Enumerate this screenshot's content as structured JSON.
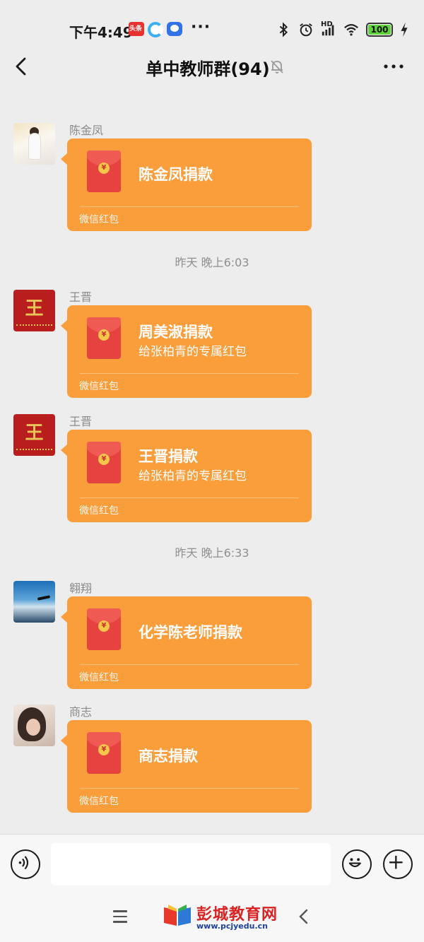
{
  "status_bar": {
    "time": "下午4:49",
    "app_badge": "头条",
    "battery": "100",
    "battery_level": 1.0,
    "network_label": "HD"
  },
  "header": {
    "title": "单中教师群(94)"
  },
  "messages": [
    {
      "sender": "陈金凤",
      "packet_title": "陈金凤捐款",
      "packet_subtitle": "",
      "packet_footer": "微信红包"
    },
    {
      "sender": "王晋",
      "packet_title": "周美淑捐款",
      "packet_subtitle": "给张柏青的专属红包",
      "packet_footer": "微信红包"
    },
    {
      "sender": "王晋",
      "packet_title": "王晋捐款",
      "packet_subtitle": "给张柏青的专属红包",
      "packet_footer": "微信红包"
    },
    {
      "sender": "翱翔",
      "packet_title": "化学陈老师捐款",
      "packet_subtitle": "",
      "packet_footer": "微信红包"
    },
    {
      "sender": "商志",
      "packet_title": "商志捐款",
      "packet_subtitle": "",
      "packet_footer": "微信红包"
    }
  ],
  "timestamps": [
    "昨天 晚上6:03",
    "昨天 晚上6:33"
  ],
  "envelope_symbol": "¥",
  "avatar_glyph": "王",
  "watermark": {
    "name": "彭城教育网",
    "url": "www.pcjyedu.cn"
  },
  "colors": {
    "background": "#ededed",
    "red_packet": "#fa9d3b",
    "envelope": "#e64340"
  }
}
